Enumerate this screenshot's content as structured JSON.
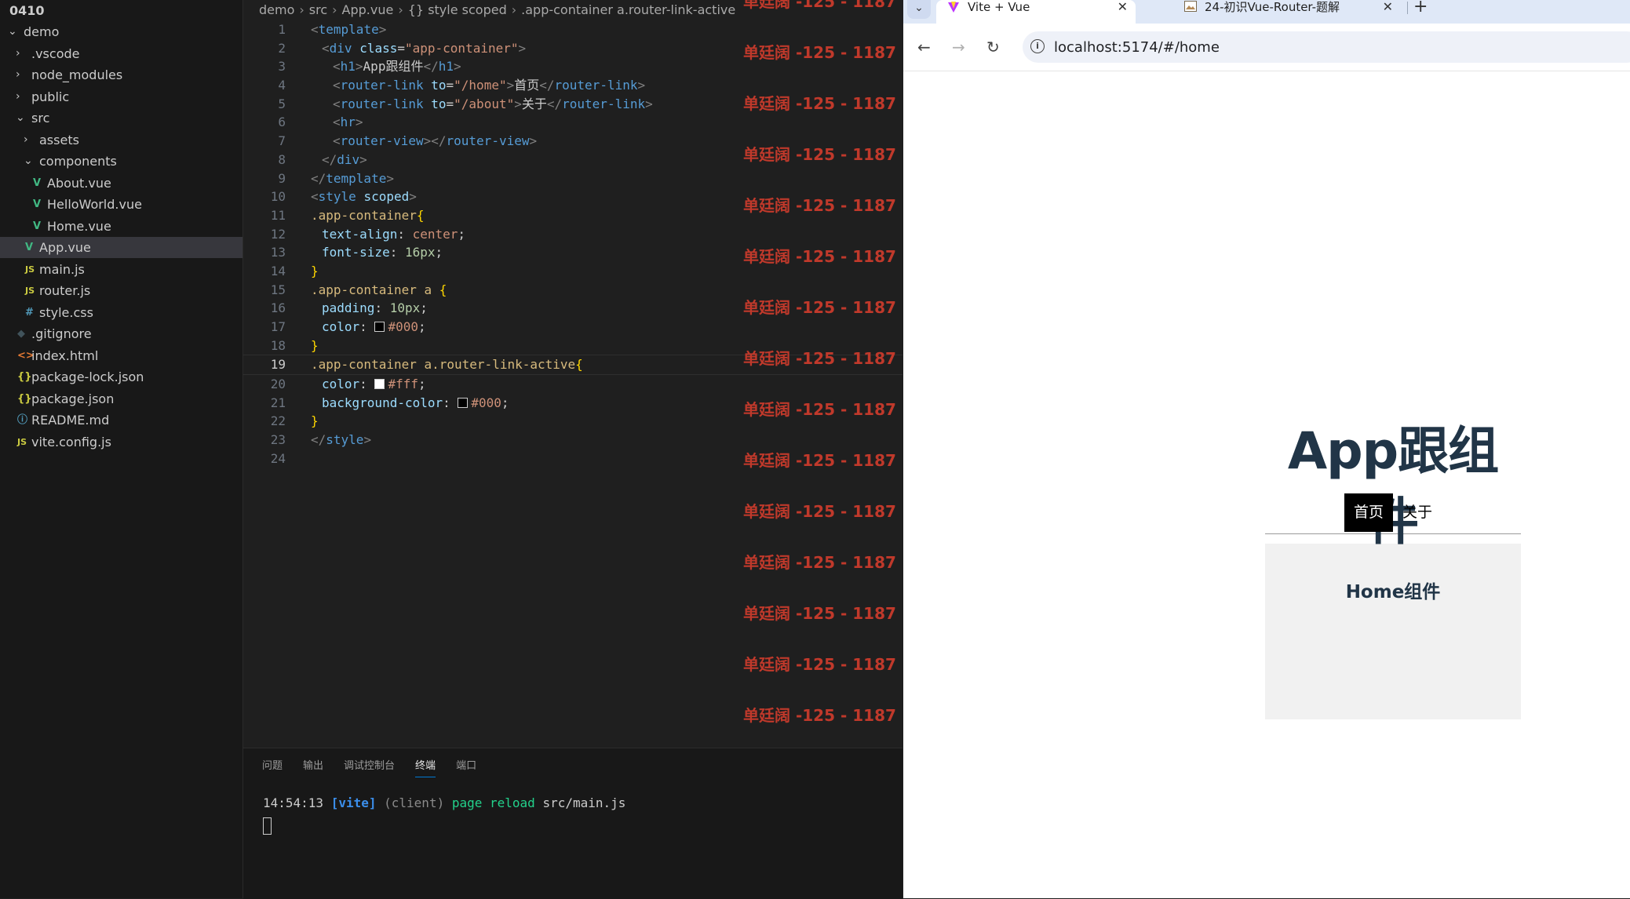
{
  "explorer": {
    "items": [
      {
        "label": "0410",
        "type": "root",
        "depth": 0
      },
      {
        "label": "demo",
        "type": "folder-open",
        "depth": 0
      },
      {
        "label": ".vscode",
        "type": "folder",
        "depth": 1
      },
      {
        "label": "node_modules",
        "type": "folder",
        "depth": 1
      },
      {
        "label": "public",
        "type": "folder",
        "depth": 1
      },
      {
        "label": "src",
        "type": "folder-open",
        "depth": 1
      },
      {
        "label": "assets",
        "type": "folder",
        "depth": 2
      },
      {
        "label": "components",
        "type": "folder-open",
        "depth": 2
      },
      {
        "label": "About.vue",
        "type": "vue",
        "depth": 3
      },
      {
        "label": "HelloWorld.vue",
        "type": "vue",
        "depth": 3
      },
      {
        "label": "Home.vue",
        "type": "vue",
        "depth": 3
      },
      {
        "label": "App.vue",
        "type": "vue",
        "depth": 2,
        "selected": true
      },
      {
        "label": "main.js",
        "type": "js",
        "depth": 2
      },
      {
        "label": "router.js",
        "type": "js",
        "depth": 2
      },
      {
        "label": "style.css",
        "type": "css",
        "depth": 2
      },
      {
        "label": ".gitignore",
        "type": "git",
        "depth": 1
      },
      {
        "label": "index.html",
        "type": "html",
        "depth": 1
      },
      {
        "label": "package-lock.json",
        "type": "json",
        "depth": 1
      },
      {
        "label": "package.json",
        "type": "json",
        "depth": 1
      },
      {
        "label": "README.md",
        "type": "info",
        "depth": 1
      },
      {
        "label": "vite.config.js",
        "type": "js",
        "depth": 1
      }
    ]
  },
  "editor": {
    "breadcrumb": [
      "demo",
      "src",
      "App.vue",
      "{} style scoped",
      ".app-container a.router-link-active"
    ],
    "current_line": 19,
    "lines": [
      {
        "n": "1",
        "tokens": [
          [
            "t-tag",
            "<"
          ],
          [
            "t-name",
            "template"
          ],
          [
            "t-tag",
            ">"
          ]
        ],
        "indent": 0
      },
      {
        "n": "2",
        "tokens": [
          [
            "t-tag",
            "<"
          ],
          [
            "t-name",
            "div"
          ],
          [
            "t-punc",
            " "
          ],
          [
            "t-attr",
            "class"
          ],
          [
            "t-punc",
            "="
          ],
          [
            "t-str",
            "\"app-container\""
          ],
          [
            "t-tag",
            ">"
          ]
        ],
        "indent": 1
      },
      {
        "n": "3",
        "tokens": [
          [
            "t-tag",
            "<"
          ],
          [
            "t-name",
            "h1"
          ],
          [
            "t-tag",
            ">"
          ],
          [
            "t-punc",
            "App跟组件"
          ],
          [
            "t-tag",
            "</"
          ],
          [
            "t-name",
            "h1"
          ],
          [
            "t-tag",
            ">"
          ]
        ],
        "indent": 2
      },
      {
        "n": "4",
        "tokens": [
          [
            "t-tag",
            "<"
          ],
          [
            "t-name",
            "router-link"
          ],
          [
            "t-punc",
            " "
          ],
          [
            "t-attr",
            "to"
          ],
          [
            "t-punc",
            "="
          ],
          [
            "t-str",
            "\"/home\""
          ],
          [
            "t-tag",
            ">"
          ],
          [
            "t-punc",
            "首页"
          ],
          [
            "t-tag",
            "</"
          ],
          [
            "t-name",
            "router-link"
          ],
          [
            "t-tag",
            ">"
          ]
        ],
        "indent": 2
      },
      {
        "n": "5",
        "tokens": [
          [
            "t-tag",
            "<"
          ],
          [
            "t-name",
            "router-link"
          ],
          [
            "t-punc",
            " "
          ],
          [
            "t-attr",
            "to"
          ],
          [
            "t-punc",
            "="
          ],
          [
            "t-str",
            "\"/about\""
          ],
          [
            "t-tag",
            ">"
          ],
          [
            "t-punc",
            "关于"
          ],
          [
            "t-tag",
            "</"
          ],
          [
            "t-name",
            "router-link"
          ],
          [
            "t-tag",
            ">"
          ]
        ],
        "indent": 2
      },
      {
        "n": "6",
        "tokens": [
          [
            "t-tag",
            "<"
          ],
          [
            "t-name",
            "hr"
          ],
          [
            "t-tag",
            ">"
          ]
        ],
        "indent": 2
      },
      {
        "n": "7",
        "tokens": [
          [
            "t-tag",
            "<"
          ],
          [
            "t-name",
            "router-view"
          ],
          [
            "t-tag",
            "></"
          ],
          [
            "t-name",
            "router-view"
          ],
          [
            "t-tag",
            ">"
          ]
        ],
        "indent": 2
      },
      {
        "n": "8",
        "tokens": [
          [
            "t-tag",
            "</"
          ],
          [
            "t-name",
            "div"
          ],
          [
            "t-tag",
            ">"
          ]
        ],
        "indent": 1
      },
      {
        "n": "9",
        "tokens": [
          [
            "t-tag",
            "</"
          ],
          [
            "t-name",
            "template"
          ],
          [
            "t-tag",
            ">"
          ]
        ],
        "indent": 0
      },
      {
        "n": "10",
        "tokens": [
          [
            "t-tag",
            "<"
          ],
          [
            "t-name",
            "style"
          ],
          [
            "t-punc",
            " "
          ],
          [
            "t-attr",
            "scoped"
          ],
          [
            "t-tag",
            ">"
          ]
        ],
        "indent": 0
      },
      {
        "n": "11",
        "tokens": [
          [
            "t-sel",
            ".app-container"
          ],
          [
            "t-brace",
            "{"
          ]
        ],
        "indent": 0
      },
      {
        "n": "12",
        "tokens": [
          [
            "t-prop",
            "text-align"
          ],
          [
            "t-punc",
            ": "
          ],
          [
            "t-val",
            "center"
          ],
          [
            "t-punc",
            ";"
          ]
        ],
        "indent": 1
      },
      {
        "n": "13",
        "tokens": [
          [
            "t-prop",
            "font-size"
          ],
          [
            "t-punc",
            ": "
          ],
          [
            "t-num",
            "16px"
          ],
          [
            "t-punc",
            ";"
          ]
        ],
        "indent": 1
      },
      {
        "n": "14",
        "tokens": [
          [
            "t-brace",
            "}"
          ]
        ],
        "indent": 0
      },
      {
        "n": "15",
        "tokens": [
          [
            "t-sel",
            ".app-container a "
          ],
          [
            "t-brace",
            "{"
          ]
        ],
        "indent": 0
      },
      {
        "n": "16",
        "tokens": [
          [
            "t-prop",
            "padding"
          ],
          [
            "t-punc",
            ": "
          ],
          [
            "t-num",
            "10px"
          ],
          [
            "t-punc",
            ";"
          ]
        ],
        "indent": 1
      },
      {
        "n": "17",
        "tokens": [
          [
            "t-prop",
            "color"
          ],
          [
            "t-punc",
            ": "
          ],
          [
            "swatch",
            "#000"
          ],
          [
            "t-val",
            "#000"
          ],
          [
            "t-punc",
            ";"
          ]
        ],
        "indent": 1
      },
      {
        "n": "18",
        "tokens": [
          [
            "t-brace",
            "}"
          ]
        ],
        "indent": 0
      },
      {
        "n": "19",
        "tokens": [
          [
            "t-sel",
            ".app-container a.router-link-active"
          ],
          [
            "t-brace",
            "{"
          ]
        ],
        "indent": 0
      },
      {
        "n": "20",
        "tokens": [
          [
            "t-prop",
            "color"
          ],
          [
            "t-punc",
            ": "
          ],
          [
            "swatch",
            "#fff"
          ],
          [
            "t-val",
            "#fff"
          ],
          [
            "t-punc",
            ";"
          ]
        ],
        "indent": 1
      },
      {
        "n": "21",
        "tokens": [
          [
            "t-prop",
            "background-color"
          ],
          [
            "t-punc",
            ": "
          ],
          [
            "swatch",
            "#000"
          ],
          [
            "t-val",
            "#000"
          ],
          [
            "t-punc",
            ";"
          ]
        ],
        "indent": 1
      },
      {
        "n": "22",
        "tokens": [
          [
            "t-brace",
            "}"
          ]
        ],
        "indent": 0
      },
      {
        "n": "23",
        "tokens": [
          [
            "t-tag",
            "</"
          ],
          [
            "t-name",
            "style"
          ],
          [
            "t-tag",
            ">"
          ]
        ],
        "indent": 0
      },
      {
        "n": "24",
        "tokens": [],
        "indent": 0
      }
    ]
  },
  "watermark": {
    "text": "单廷阔 -125 - 1187",
    "count": 18,
    "color": "#c0392b"
  },
  "panel": {
    "tabs": [
      "问题",
      "输出",
      "调试控制台",
      "终端",
      "端口"
    ],
    "active_tab": "终端",
    "terminal": {
      "time": "14:54:13",
      "tag": "[vite]",
      "client": "(client)",
      "message": "page reload",
      "file": "src/main.js"
    }
  },
  "browser": {
    "tabs": [
      {
        "title": "Vite + Vue",
        "icon": "vite-logo-icon",
        "active": true
      },
      {
        "title": "24-初识Vue-Router-题解",
        "icon": "page-thumbnail-icon",
        "active": false
      }
    ],
    "url": "localhost:5174/#/home",
    "page": {
      "heading": "App跟组件",
      "links": [
        {
          "label": "首页",
          "active": true
        },
        {
          "label": "关于",
          "active": false
        }
      ],
      "route_view_title": "Home组件"
    }
  }
}
